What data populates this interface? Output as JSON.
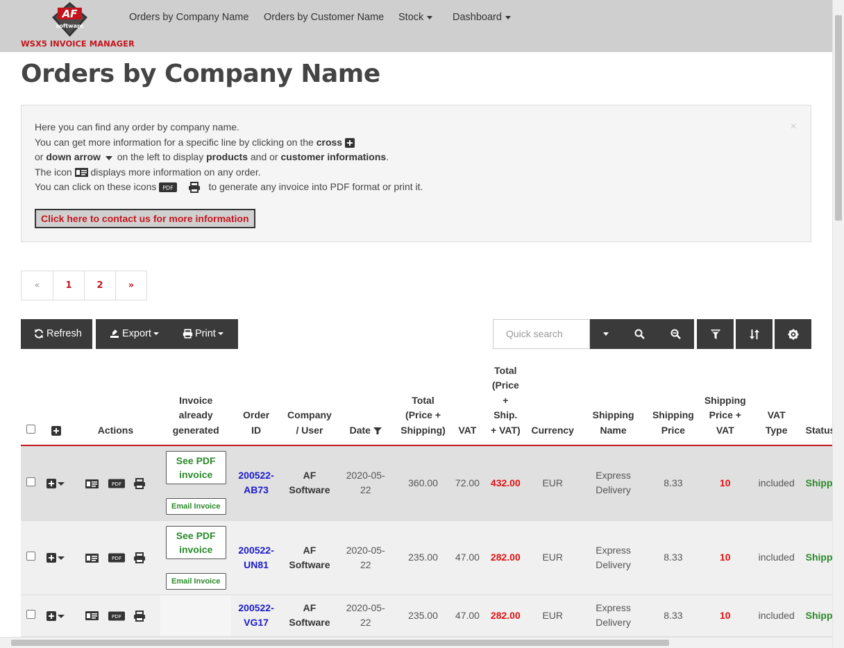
{
  "brand": {
    "logo_text": "software",
    "name": "WSX5 INVOICE MANAGER"
  },
  "nav": {
    "items": [
      "Orders by Company Name",
      "Orders by Customer Name",
      "Stock",
      "Dashboard"
    ]
  },
  "page_title": "Orders by Company Name",
  "info": {
    "line1": "Here you can find any order by company name.",
    "line2_a": "You can get more information for a specific line by clicking on the ",
    "line2_b": "cross",
    "line3_a": "or ",
    "line3_b": "down arrow",
    "line3_c": " on the left to display ",
    "line3_d": "products",
    "line3_e": " and or ",
    "line3_f": "customer informations",
    "line3_g": ".",
    "line4_a": "The icon ",
    "line4_b": " displays more information on any order.",
    "line5_a": "You can click on these icons ",
    "line5_b": " to generate any invoice into PDF format or print it.",
    "pdf_icon": "PDF",
    "contact_button": "Click here to contact us for more information",
    "close": "×"
  },
  "pagination": [
    "«",
    "1",
    "2",
    "»"
  ],
  "toolbar": {
    "refresh": "Refresh",
    "export": "Export",
    "print": "Print",
    "search_placeholder": "Quick search"
  },
  "table": {
    "headers": {
      "actions": "Actions",
      "invoice": [
        "Invoice",
        "already",
        "generated"
      ],
      "order_id": [
        "Order",
        "ID"
      ],
      "company": [
        "Company",
        "/ User"
      ],
      "date": "Date",
      "total": [
        "Total",
        "(Price +",
        "Shipping)"
      ],
      "vat": "VAT",
      "total_vat": [
        "Total",
        "(Price",
        "+",
        "Ship.",
        "+ VAT)"
      ],
      "currency": "Currency",
      "ship_name": [
        "Shipping",
        "Name"
      ],
      "ship_price": [
        "Shipping",
        "Price"
      ],
      "ship_vat": [
        "Shipping",
        "Price +",
        "VAT"
      ],
      "vat_type": [
        "VAT",
        "Type"
      ],
      "status": "Status"
    },
    "see_pdf": [
      "See PDF",
      "invoice"
    ],
    "email_invoice": "Email Invoice",
    "rows": [
      {
        "order_id": [
          "200522-",
          "AB73"
        ],
        "company": [
          "AF",
          "Software"
        ],
        "date": [
          "2020-05-",
          "22"
        ],
        "total": "360.00",
        "vat": "72.00",
        "total_vat": "432.00",
        "currency": "EUR",
        "ship_name": [
          "Express",
          "Delivery"
        ],
        "ship_price": "8.33",
        "ship_vat": "10",
        "vat_type": "included",
        "status": "Shipped",
        "invoice": true
      },
      {
        "order_id": [
          "200522-",
          "UN81"
        ],
        "company": [
          "AF",
          "Software"
        ],
        "date": [
          "2020-05-",
          "22"
        ],
        "total": "235.00",
        "vat": "47.00",
        "total_vat": "282.00",
        "currency": "EUR",
        "ship_name": [
          "Express",
          "Delivery"
        ],
        "ship_price": "8.33",
        "ship_vat": "10",
        "vat_type": "included",
        "status": "Shipped",
        "invoice": true
      },
      {
        "order_id": [
          "200522-",
          "VG17"
        ],
        "company": [
          "AF",
          "Software"
        ],
        "date": [
          "2020-05-",
          "22"
        ],
        "total": "235.00",
        "vat": "47.00",
        "total_vat": "282.00",
        "currency": "EUR",
        "ship_name": [
          "Express",
          "Delivery"
        ],
        "ship_price": "8.33",
        "ship_vat": "10",
        "vat_type": "included",
        "status": "Shipped",
        "invoice": false
      }
    ]
  },
  "colors": {
    "accent": "#c4151c",
    "link": "#1a1acc",
    "success": "#2a8a2a",
    "dark_button": "#3a3a3a",
    "navbar": "#cfcfcf"
  }
}
